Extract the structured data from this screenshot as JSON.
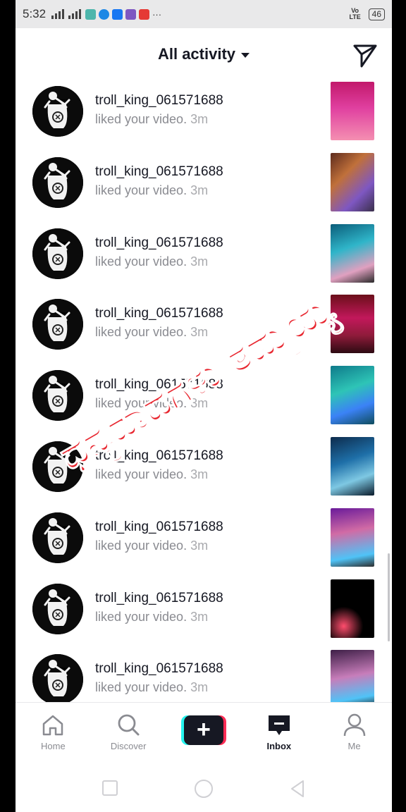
{
  "status_bar": {
    "time": "5:32",
    "network": "4G",
    "volte": "Vo LTE",
    "battery": "46",
    "more": "···"
  },
  "header": {
    "title": "All activity",
    "title_icon": "caret-down-icon",
    "dm_icon": "direct-message-icon"
  },
  "notifications": [
    {
      "username": "troll_king_061571688",
      "action": "liked your video.",
      "time": "3m"
    },
    {
      "username": "troll_king_061571688",
      "action": "liked your video.",
      "time": "3m"
    },
    {
      "username": "troll_king_061571688",
      "action": "liked your video.",
      "time": "3m"
    },
    {
      "username": "troll_king_061571688",
      "action": "liked your video.",
      "time": "3m"
    },
    {
      "username": "troll_king_061571688",
      "action": "liked your video.",
      "time": "3m"
    },
    {
      "username": "troll_king_061571688",
      "action": "liked your video.",
      "time": "3m"
    },
    {
      "username": "troll_king_061571688",
      "action": "liked your video.",
      "time": "3m"
    },
    {
      "username": "troll_king_061571688",
      "action": "liked your video.",
      "time": "3m"
    },
    {
      "username": "troll_king_061571688",
      "action": "liked your video.",
      "time": "3m"
    }
  ],
  "overlay_text": "ಧನ್ಯವಾದಗಳು ತಮ್ಮಯ್ಯ",
  "bottom_nav": {
    "home": "Home",
    "discover": "Discover",
    "create": "+",
    "inbox": "Inbox",
    "me": "Me"
  },
  "colors": {
    "accent_red": "#fe2c55",
    "accent_cyan": "#25f4ee",
    "text_primary": "#161823",
    "text_secondary": "#8a8b91",
    "overlay_red": "#e8262f"
  }
}
